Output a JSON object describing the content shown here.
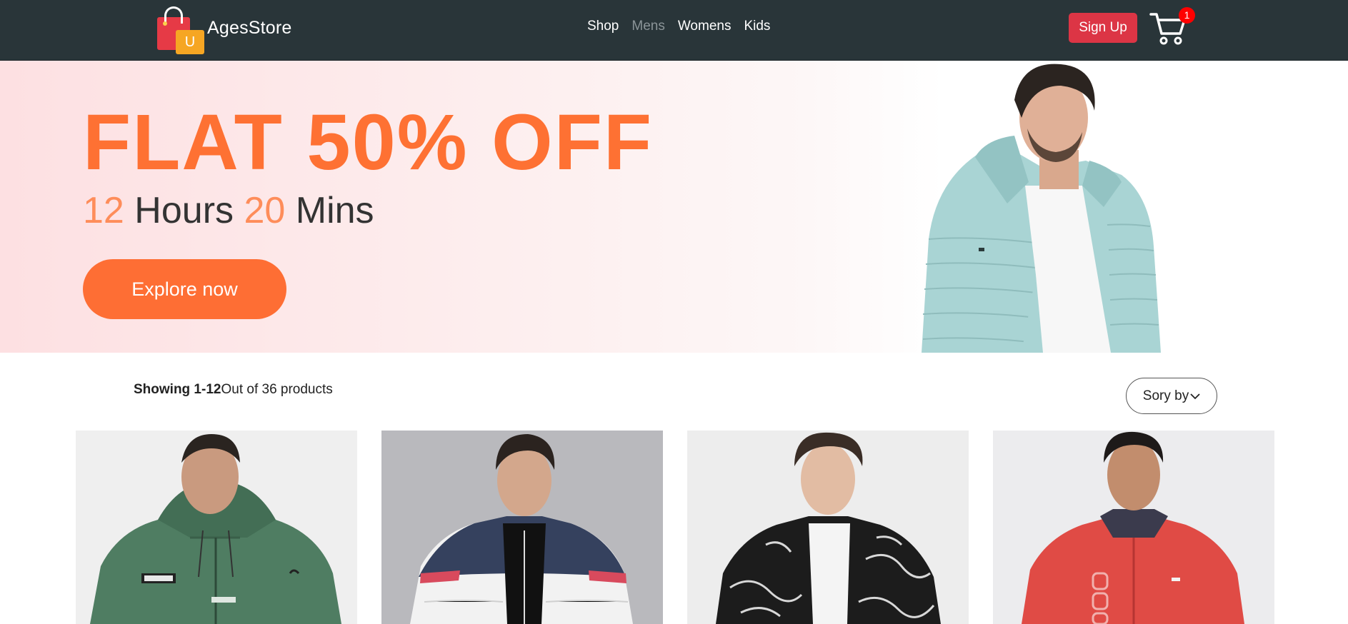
{
  "brand": {
    "name": "AgesStore",
    "logo_letter": "U"
  },
  "nav": {
    "links": [
      {
        "label": "Shop"
      },
      {
        "label": "Mens"
      },
      {
        "label": "Womens"
      },
      {
        "label": "Kids"
      }
    ],
    "active": "Mens"
  },
  "header": {
    "signup_label": "Sign Up",
    "cart_count": "1",
    "cart_icon": "shopping-cart-icon"
  },
  "hero": {
    "title": "FLAT 50% OFF",
    "hours_value": "12",
    "hours_unit": "Hours",
    "mins_value": "20",
    "mins_unit": "Mins",
    "cta_label": "Explore now"
  },
  "listing": {
    "showing_range": "Showing 1-12",
    "showing_total": "Out of 36 products",
    "sort_label": "Sory by",
    "sort_icon": "chevron-down-icon"
  },
  "colors": {
    "navbar_bg": "#293539",
    "accent_orange": "#fe7133",
    "signup_red": "#dc3545",
    "badge_red": "#ff0000"
  }
}
